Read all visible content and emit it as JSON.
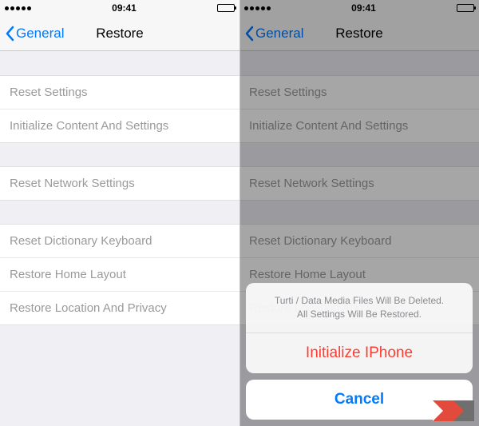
{
  "status": {
    "time": "09:41"
  },
  "nav": {
    "back_label": "General",
    "title": "Restore"
  },
  "groups": {
    "g1": {
      "reset_settings": "Reset Settings",
      "init_content": "Initialize Content And Settings"
    },
    "g2": {
      "reset_network": "Reset Network Settings"
    },
    "g3": {
      "reset_dict": "Reset Dictionary Keyboard",
      "restore_home": "Restore Home Layout",
      "restore_loc": "Restore Location And Privacy"
    }
  },
  "sheet": {
    "message_line1": "Turti / Data Media Files Will Be Deleted.",
    "message_line2": "All Settings Will Be Restored.",
    "destructive": "Initialize IPhone",
    "cancel": "Cancel"
  }
}
